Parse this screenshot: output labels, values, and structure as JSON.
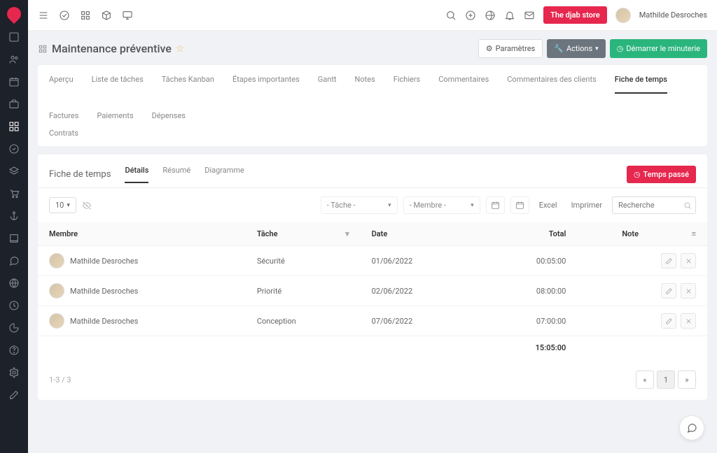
{
  "brand_button": "The djab store",
  "user": {
    "name": "Mathilde Desroches"
  },
  "page": {
    "title": "Maintenance préventive",
    "params_label": "Paramètres",
    "actions_label": "Actions",
    "start_timer_label": "Démarrer le minuterie"
  },
  "main_tabs": {
    "t0": "Aperçu",
    "t1": "Liste de tâches",
    "t2": "Tâches Kanban",
    "t3": "Étapes importantes",
    "t4": "Gantt",
    "t5": "Notes",
    "t6": "Fichiers",
    "t7": "Commentaires",
    "t8": "Commentaires des clients",
    "t9": "Fiche de temps",
    "t10": "Factures",
    "t11": "Paiements",
    "t12": "Dépenses",
    "t13": "Contrats"
  },
  "section": {
    "title": "Fiche de temps",
    "subtabs": {
      "s0": "Détails",
      "s1": "Résumé",
      "s2": "Diagramme"
    },
    "time_button": "Temps passé"
  },
  "filters": {
    "page_size": "10",
    "task_placeholder": "- Tâche -",
    "member_placeholder": "- Membre -",
    "excel": "Excel",
    "print": "Imprimer",
    "search_placeholder": "Recherche"
  },
  "columns": {
    "member": "Membre",
    "task": "Tâche",
    "date": "Date",
    "total": "Total",
    "note": "Note"
  },
  "rows": {
    "r0": {
      "member": "Mathilde Desroches",
      "task": "Sécurité",
      "date": "01/06/2022",
      "total": "00:05:00"
    },
    "r1": {
      "member": "Mathilde Desroches",
      "task": "Priorité",
      "date": "02/06/2022",
      "total": "08:00:00"
    },
    "r2": {
      "member": "Mathilde Desroches",
      "task": "Conception",
      "date": "07/06/2022",
      "total": "07:00:00"
    }
  },
  "sum_total": "15:05:00",
  "pagination": {
    "range": "1-3 / 3",
    "current": "1"
  }
}
